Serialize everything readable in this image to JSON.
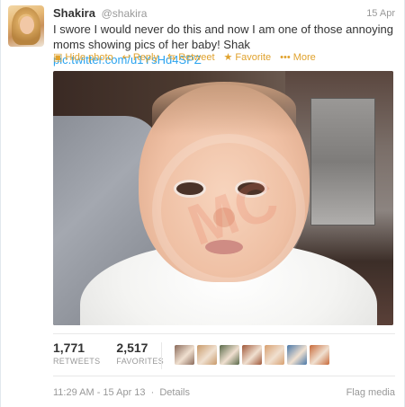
{
  "tweet": {
    "name": "Shakira",
    "handle": "@shakira",
    "date": "15 Apr",
    "text": "I swore I would never do this and now I am one of those annoying moms showing pics of her baby! Shak ",
    "link": "pic.twitter.com/u1YsHd4SPZ"
  },
  "actions": {
    "hide_photo": "Hide photo",
    "reply": "Reply",
    "retweet": "Retweet",
    "favorite": "Favorite",
    "more": "More"
  },
  "icons": {
    "hide_photo": "photo-icon",
    "reply": "reply-icon",
    "retweet": "retweet-icon",
    "favorite": "star-icon",
    "more": "ellipsis-icon"
  },
  "stats": {
    "retweets_count": "1,771",
    "retweets_label": "RETWEETS",
    "favorites_count": "2,517",
    "favorites_label": "FAVORITES"
  },
  "favoriters": [
    {
      "color": "#8a6a5a"
    },
    {
      "color": "#c89a6a"
    },
    {
      "color": "#5a6a4a"
    },
    {
      "color": "#a0583a"
    },
    {
      "color": "#d8a070"
    },
    {
      "color": "#4a78a8"
    },
    {
      "color": "#c86a3a"
    }
  ],
  "footer": {
    "timestamp": "11:29 AM - 15 Apr 13",
    "separator": "·",
    "details": "Details",
    "flag": "Flag media"
  },
  "colors": {
    "accent": "#e0a22d",
    "link": "#2aa3ef",
    "muted": "#999999"
  }
}
